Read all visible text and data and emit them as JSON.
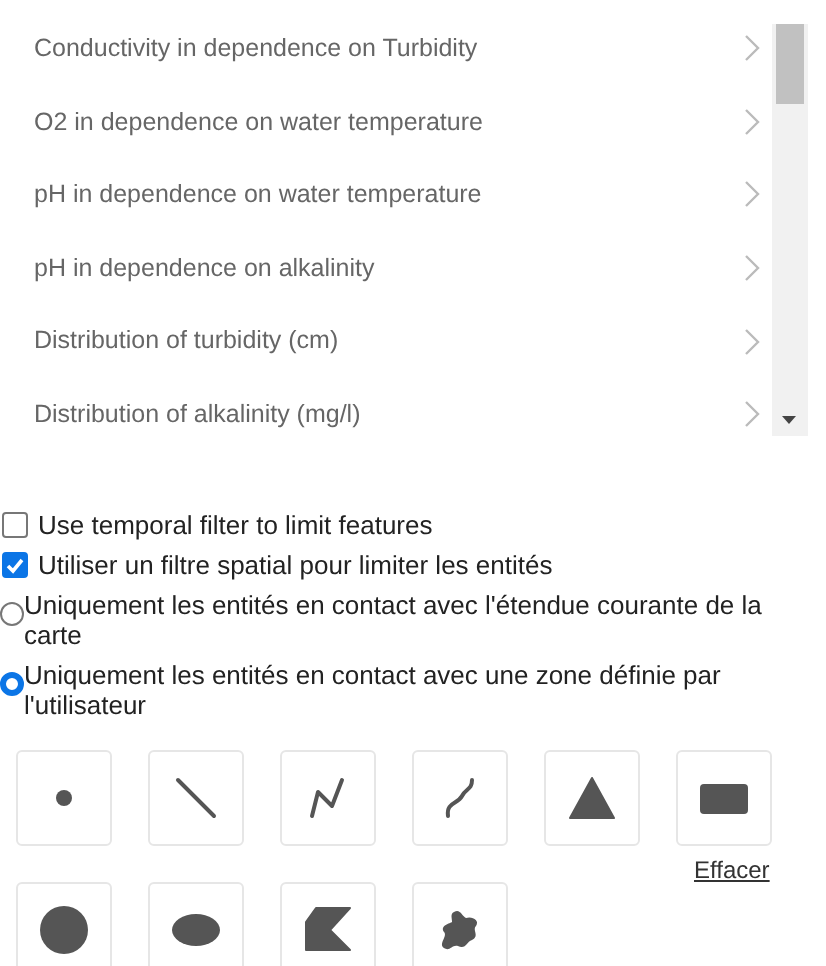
{
  "list": [
    {
      "label": "Conductivity in dependence on Turbidity"
    },
    {
      "label": "O2 in dependence on water temperature"
    },
    {
      "label": "pH in dependence on water temperature"
    },
    {
      "label": "pH in dependence on alkalinity"
    },
    {
      "label": "Distribution of turbidity (cm)"
    },
    {
      "label": "Distribution of alkalinity (mg/l)"
    }
  ],
  "options": [
    {
      "kind": "checkbox",
      "label": "Use temporal filter to limit features",
      "checked": false
    },
    {
      "kind": "checkbox",
      "label": "Utiliser un filtre spatial pour limiter les entités",
      "checked": true
    },
    {
      "kind": "radio",
      "label": "Uniquement les entités en contact avec l'étendue courante de la carte",
      "selected": false
    },
    {
      "kind": "radio",
      "label": "Uniquement les entités en contact avec une zone définie par l'utilisateur",
      "selected": true
    }
  ],
  "tools": [
    {
      "kind": "point"
    },
    {
      "kind": "line"
    },
    {
      "kind": "polyline"
    },
    {
      "kind": "freehand-line"
    },
    {
      "kind": "triangle"
    },
    {
      "kind": "rectangle"
    },
    {
      "kind": "circle"
    },
    {
      "kind": "ellipse"
    },
    {
      "kind": "polygon"
    },
    {
      "kind": "freehand-polygon"
    }
  ],
  "clear_link": "Effacer"
}
